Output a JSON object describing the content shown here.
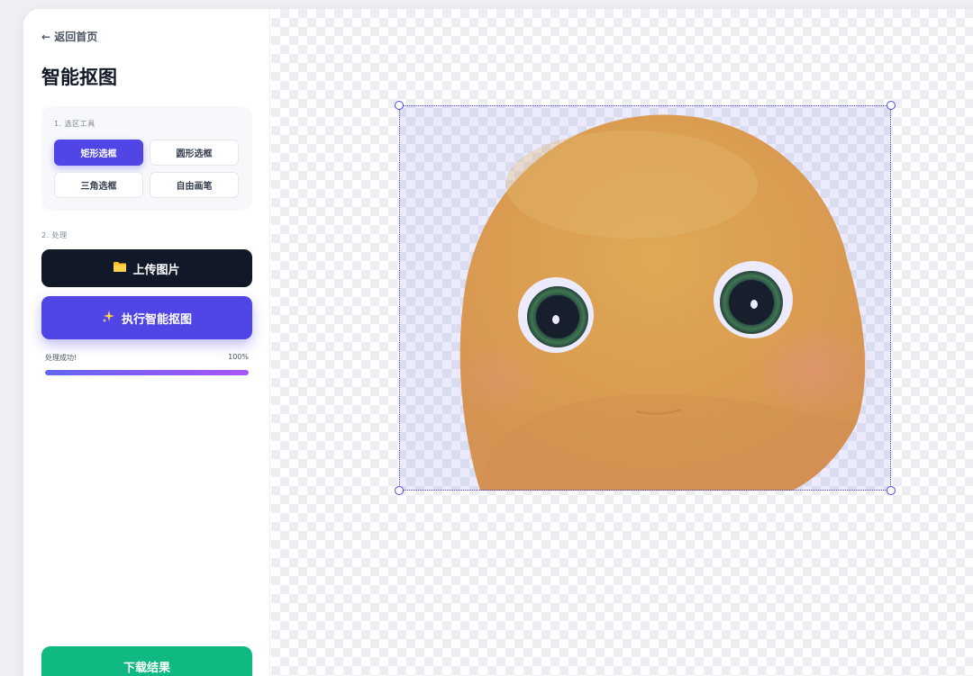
{
  "nav": {
    "back_label": "← 返回首页"
  },
  "page": {
    "title": "智能抠图"
  },
  "tools": {
    "section_label": "1. 选区工具",
    "items": [
      {
        "label": "矩形选框",
        "active": true
      },
      {
        "label": "圆形选框",
        "active": false
      },
      {
        "label": "三角选框",
        "active": false
      },
      {
        "label": "自由画笔",
        "active": false
      }
    ]
  },
  "process": {
    "section_label": "2. 处理",
    "upload_label": "上传图片",
    "upload_icon": "folder-icon",
    "ai_label": "执行智能抠图",
    "ai_icon": "sparkles-icon",
    "status_text": "处理成功!",
    "progress_text": "100%",
    "progress": 1.0
  },
  "download": {
    "label": "下载结果"
  },
  "colors": {
    "accent": "#4f46e5",
    "dark": "#111827",
    "success": "#10b981",
    "progress_start": "#6366f1",
    "progress_end": "#a855f7"
  }
}
